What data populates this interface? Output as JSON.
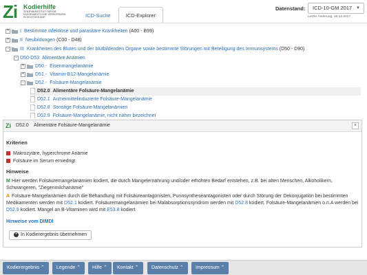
{
  "header": {
    "logo_mark": "Zi",
    "logo_title": "Kodierhilfe",
    "logo_subtitle": "Zentralinstitut für die kassenärztliche Versorgung in Deutschland",
    "tabs": [
      {
        "label": "ICD-Suche",
        "active": false
      },
      {
        "label": "ICD-Explorer",
        "active": true
      }
    ],
    "datestand_label": "Datenstand:",
    "version_value": "ICD-10-GM 2017",
    "last_change": "Letzte Änderung: 18.12.2017"
  },
  "tree": [
    {
      "toggle": "+",
      "code": "I",
      "label": "Bestimmte infektiöse und parasitäre Krankheiten",
      "range": "(A00 - B99)"
    },
    {
      "toggle": "+",
      "code": "II",
      "label": "Neubildungen",
      "range": "(C00 - D48)"
    },
    {
      "toggle": "-",
      "code": "III",
      "label": "Krankheiten des Blutes und der blutbildenden Organe sowie bestimmte Störungen mit Beteiligung des Immunsystems",
      "range": "(D50 - D90)"
    },
    {
      "toggle": "-",
      "code": "D50-D53",
      "label": "Alimentäre Anämien",
      "range": ""
    },
    {
      "toggle": "+",
      "code": "D50.-",
      "label": "Eisenmangelanämie",
      "range": ""
    },
    {
      "toggle": "+",
      "code": "D51.-",
      "label": "Vitamin-B12-Mangelanämie",
      "range": ""
    },
    {
      "toggle": "-",
      "code": "D52.-",
      "label": "Folsäure-Mangelanämie",
      "range": ""
    },
    {
      "toggle": "",
      "code": "D52.0",
      "label": "Alimentäre Folsäure-Mangelanämie",
      "range": "",
      "selected": true
    },
    {
      "toggle": "",
      "code": "D52.1",
      "label": "Arzneimittelinduzierte Folsäure-Mangelanämie",
      "range": ""
    },
    {
      "toggle": "",
      "code": "D52.8",
      "label": "Sonstige Folsäure-Mangelanämien",
      "range": ""
    },
    {
      "toggle": "",
      "code": "D52.9",
      "label": "Folsäure-Mangelanämie, nicht näher bezeichnet",
      "range": ""
    }
  ],
  "detail": {
    "code": "D52.0",
    "title": "Alimentäre Folsäure-Mangelanämie",
    "close": "×",
    "criteria_heading": "Kriterien",
    "criteria": [
      "Makrozytäre, hyperchrome Anämie",
      "Folsäure im Serum erniedrigt"
    ],
    "hints_heading": "Hinweise",
    "hint_m_mark": "M",
    "hint_m_text": "Hier werden Folsäuremangelanämien kodiert, die durch Mangelernährung und/oder erhöhten Bedarf entstehen, z.B. bei alten Menschen, Alkoholikern, Schwangeren, \"Ziegenmilchanämie\"",
    "hint_a_mark": "A",
    "hint_a_text_1": "Folsäure-Mangelanämien durch die Behandlung mit Folsäureantagonisten, Purinsyntheseantagonisten oder durch Störung der Dekonjugation bei bestimmten Medikamenten werden mit ",
    "hint_a_link_1": "D52.1",
    "hint_a_text_2": " kodiert. Folsäuremangelanämien bei Malabsorptionssyndrom werden mit ",
    "hint_a_link_2": "D52.8",
    "hint_a_text_3": " kodiert. Folsäure-Mangelanämien o.n.A werden bei ",
    "hint_a_link_3": "D52.9",
    "hint_a_text_4": " kodiert. Mangel an B-Vitaminen wird mit ",
    "hint_a_link_4": "E53.8",
    "hint_a_text_5": " kodiert",
    "dimdi_link": "Hinweise vom DIMDI",
    "add_button": "In Kodierergebnis übernehmen"
  },
  "footer": [
    "Kodierergebnis ⌃",
    "Legende ⌃",
    "Hilfe ⌃",
    "Kontakt ⌃",
    "Datenschutz ⌃",
    "Impressum ⌃"
  ]
}
